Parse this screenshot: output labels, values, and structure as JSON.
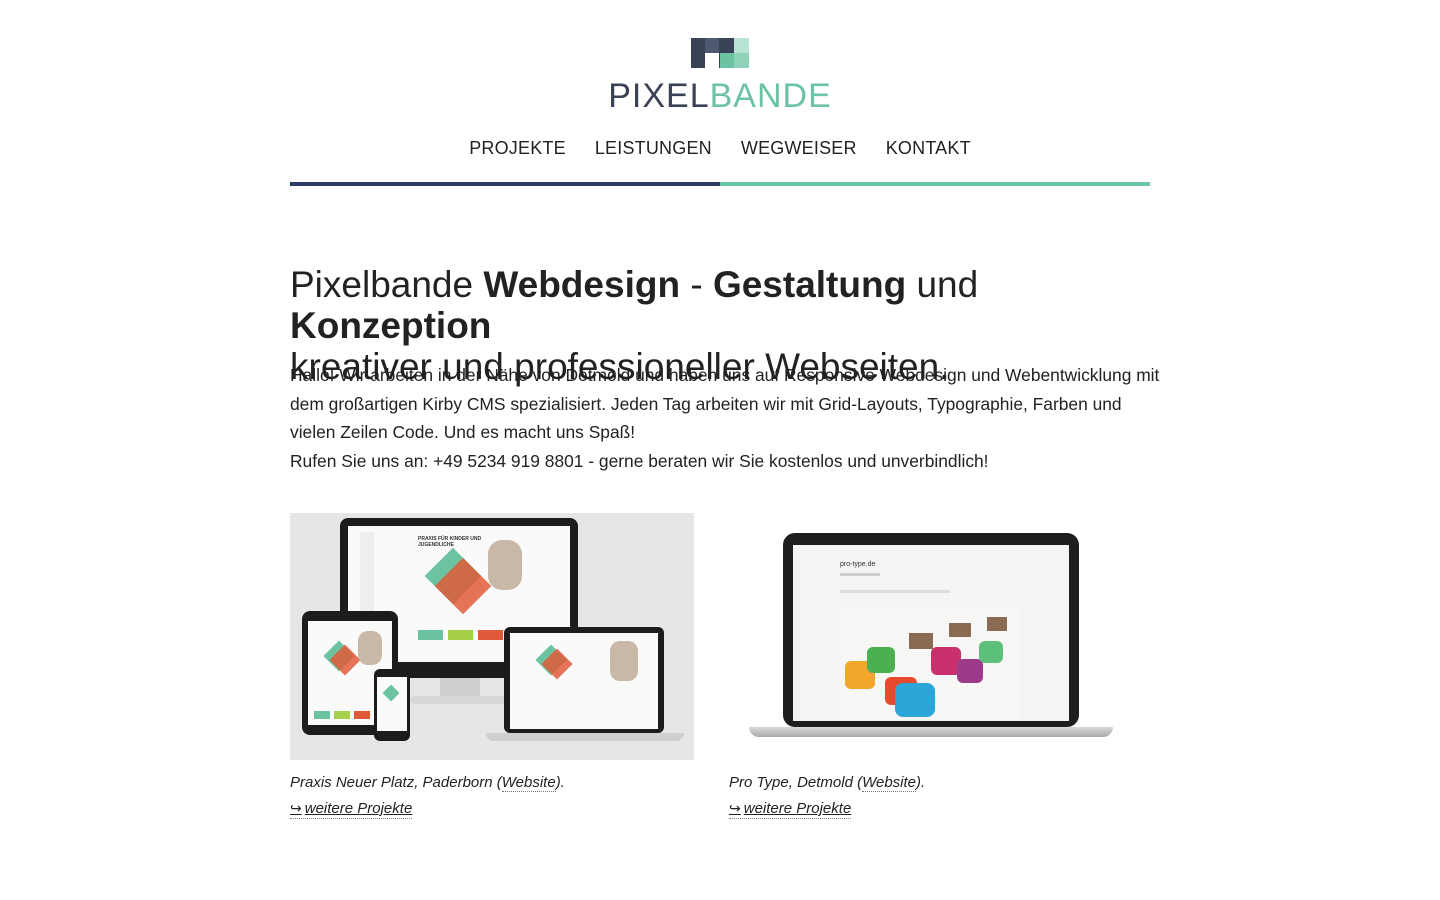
{
  "brand": {
    "name_part1": "PIXEL",
    "name_part2": "BANDE",
    "colors": {
      "dark": "#3a4256",
      "accent": "#6cc3a2",
      "navy": "#2f3a64"
    }
  },
  "nav": {
    "items": [
      {
        "label": "PROJEKTE"
      },
      {
        "label": "LEISTUNGEN"
      },
      {
        "label": "WEGWEISER"
      },
      {
        "label": "KONTAKT"
      }
    ]
  },
  "headline": {
    "part1": "Pixelbande ",
    "bold1": "Webdesign",
    "part2": " - ",
    "bold2": "Gestaltung",
    "part3": " und ",
    "bold3": "Konzeption",
    "part4": "kreativer und professioneller Webseiten."
  },
  "intro": {
    "paragraph": "Hallo! Wir arbeiten in der Nähe von Detmold und haben uns auf Responsive Webdesign und Webentwicklung mit dem großartigen Kirby CMS spezialisiert. Jeden Tag arbeiten wir mit Grid-Layouts, Typographie, Farben und vielen Zeilen Code. Und es macht uns Spaß!",
    "phone_line": "Rufen Sie uns an: +49 5234 919 8801 - gerne beraten wir Sie kostenlos und unverbindlich!"
  },
  "projects": [
    {
      "caption_text": "Praxis Neuer Platz, Paderborn (",
      "link_label": "Website",
      "caption_end": ").",
      "more_label": "weitere Projekte",
      "screen_title": "PRAXIS FÜR KINDER UND JUGENDLICHE"
    },
    {
      "caption_text": "Pro Type, Detmold (",
      "link_label": "Website",
      "caption_end": ").",
      "more_label": "weitere Projekte",
      "screen_title": "pro-type.de"
    }
  ]
}
